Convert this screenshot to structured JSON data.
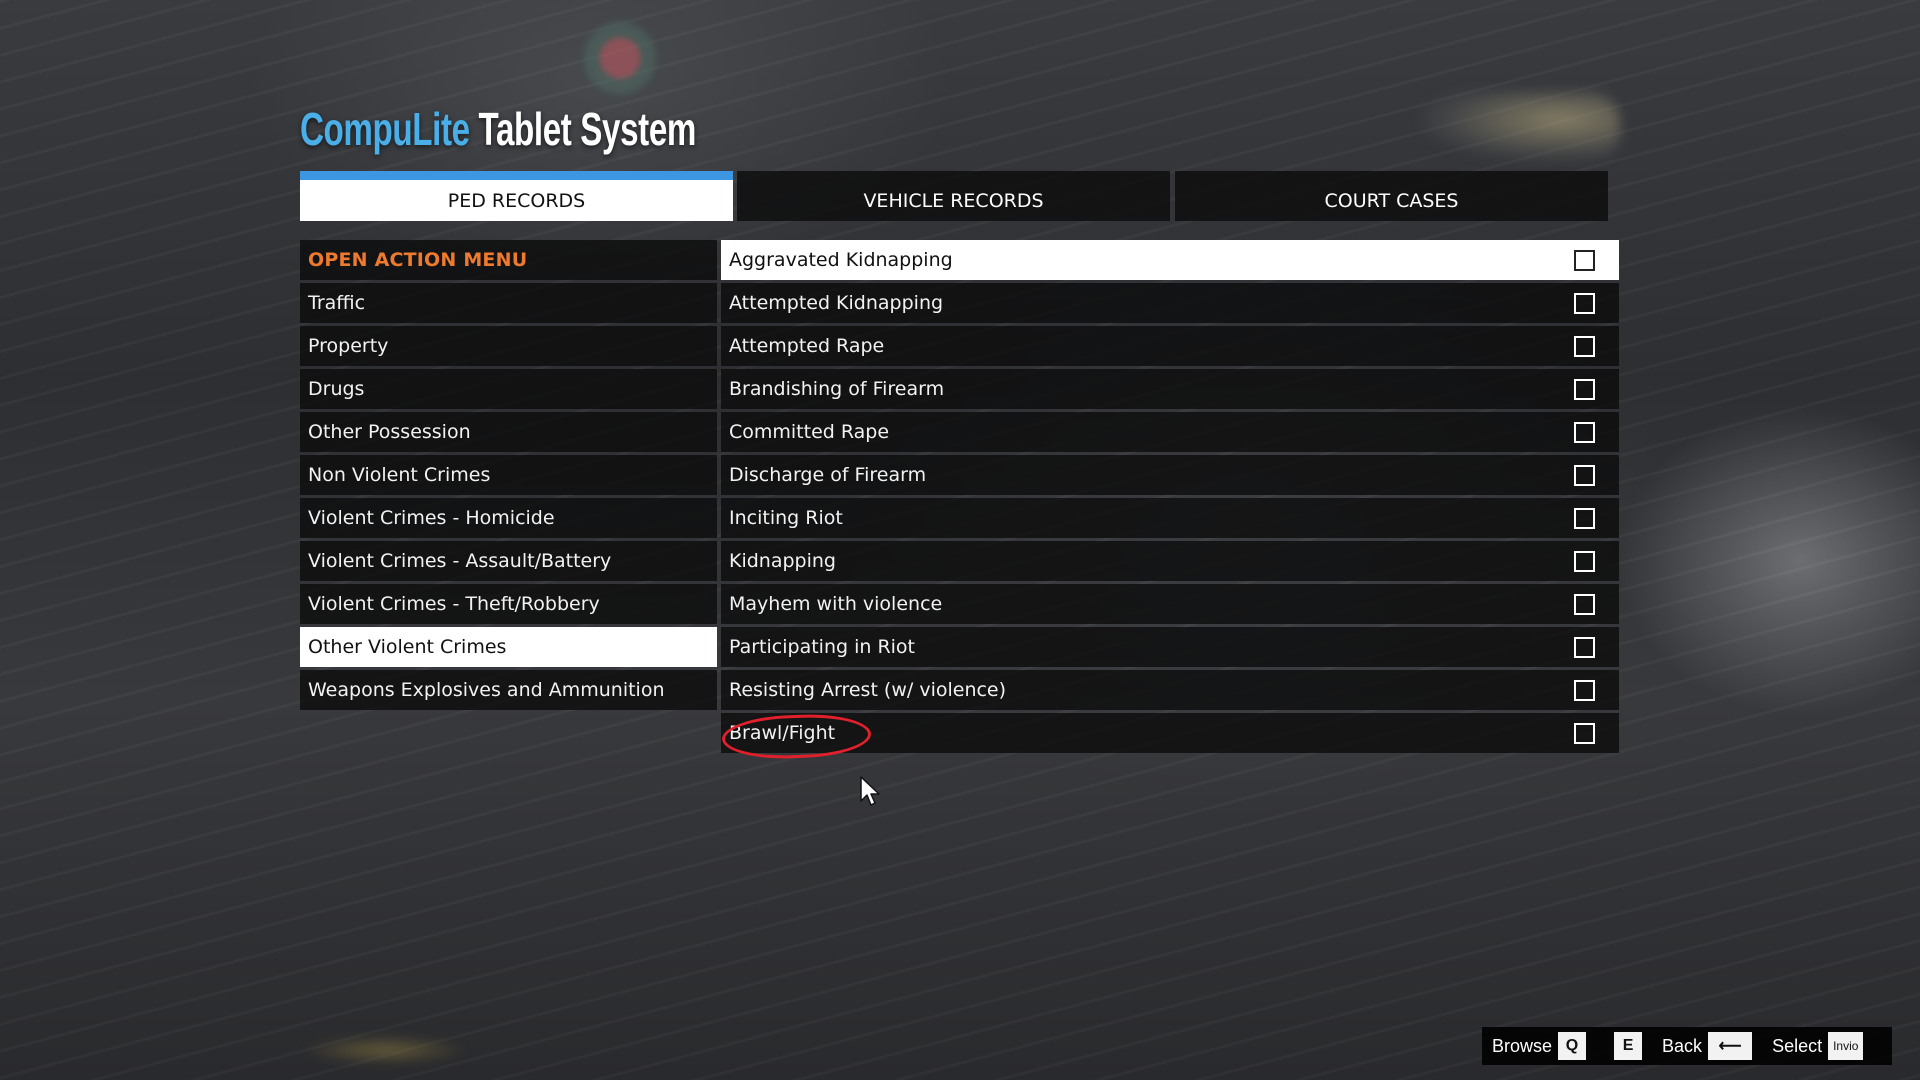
{
  "app": {
    "title_brand": "CompuLite",
    "title_rest": "Tablet System"
  },
  "tabs": [
    {
      "label": "PED RECORDS",
      "active": true
    },
    {
      "label": "VEHICLE RECORDS",
      "active": false
    },
    {
      "label": "COURT CASES",
      "active": false
    }
  ],
  "sidebar": {
    "items": [
      {
        "label": "OPEN ACTION MENU"
      },
      {
        "label": "Traffic"
      },
      {
        "label": "Property"
      },
      {
        "label": "Drugs"
      },
      {
        "label": "Other Possession"
      },
      {
        "label": "Non Violent Crimes"
      },
      {
        "label": "Violent Crimes - Homicide"
      },
      {
        "label": "Violent Crimes - Assault/Battery"
      },
      {
        "label": "Violent Crimes - Theft/Robbery"
      },
      {
        "label": "Other Violent Crimes"
      },
      {
        "label": "Weapons Explosives and Ammunition"
      }
    ],
    "selected_index": 9
  },
  "crimes": {
    "items": [
      {
        "label": "Aggravated Kidnapping",
        "checked": false
      },
      {
        "label": "Attempted Kidnapping",
        "checked": false
      },
      {
        "label": "Attempted Rape",
        "checked": false
      },
      {
        "label": "Brandishing of Firearm",
        "checked": false
      },
      {
        "label": "Committed Rape",
        "checked": false
      },
      {
        "label": "Discharge of Firearm",
        "checked": false
      },
      {
        "label": "Inciting Riot",
        "checked": false
      },
      {
        "label": "Kidnapping",
        "checked": false
      },
      {
        "label": "Mayhem with violence",
        "checked": false
      },
      {
        "label": "Participating in Riot",
        "checked": false
      },
      {
        "label": "Resisting Arrest (w/ violence)",
        "checked": false
      },
      {
        "label": "Brawl/Fight",
        "checked": false
      }
    ],
    "highlighted_index": 0
  },
  "helpbar": {
    "browse_label": "Browse",
    "browse_key": "Q",
    "e_key": "E",
    "back_label": "Back",
    "back_key": "⟵",
    "select_label": "Select",
    "select_key": "Invio"
  },
  "colors": {
    "brand_blue": "#4aaee8",
    "tab_accent": "#3d96e1",
    "action_orange": "#ee7a2e",
    "annotation_red": "#e1202c"
  }
}
